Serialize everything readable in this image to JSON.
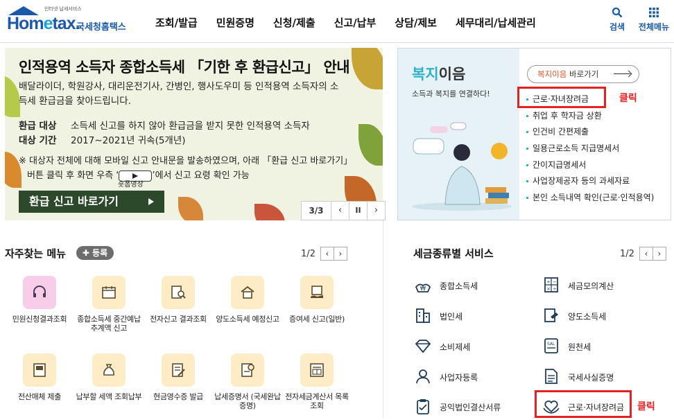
{
  "header": {
    "logo_small": "인터넷 납세서비스",
    "logo_word_a": "Hom",
    "logo_word_e": "e",
    "logo_word_b": "tax.",
    "logo_sub": "국세청홈택스",
    "nav": [
      "조회/발급",
      "민원증명",
      "신청/제출",
      "신고/납부",
      "상담/제보",
      "세무대리/납세관리"
    ],
    "search_label": "검색",
    "menu_label": "전체메뉴"
  },
  "banner": {
    "title": "인적용역 소득자 종합소득세 「기한 후 환급신고」 안내",
    "desc": "배달라이더, 학원강사, 대리운전기사, 간병인, 행사도우미 등 인적용역 소득자의 소득세 환급금을 찾아드립니다.",
    "row1_label": "환급 대상",
    "row1_value": "소득세 신고를 하지 않아 환급금을 받지 못한 인적용역 소득자",
    "row2_label": "대상 기간",
    "row2_value": "2017∼2021년 귀속(5개년)",
    "note_a": "※ 대상자 전체에 대해 모바일 신고 안내문을 발송하였으며, 아래 「환급 신고 바로가기」",
    "note_b1": "버튼 클릭 후 화면 우측 ‘",
    "note_b2": "’에서 신고 요령 확인 가능",
    "video_label": "숏폼영상",
    "button": "환급 신고 바로가기",
    "page": "3/3",
    "prev": "‹",
    "pause": "II",
    "next": "›"
  },
  "welfare": {
    "title_acc": "복지",
    "title_rest": "이음",
    "subtitle": "소득과 복지를 연결하다!",
    "go_acc": "복지이음",
    "go_rest": " 바로가기",
    "items": [
      "근로·자녀장려금",
      "취업 후 학자금 상환",
      "인건비 간편제출",
      "일용근로소득 지급명세서",
      "간이지급명세서",
      "사업장제공자 등의 과세자료",
      "본인 소득내역 확인(근로·인적용역)"
    ],
    "click_label": "클릭"
  },
  "favorites": {
    "title": "자주찾는 메뉴",
    "register": "✚ 등록",
    "page": "1/2",
    "prev": "‹",
    "next": "›",
    "items": [
      {
        "label": "민원신청결과조회",
        "icon": "headset-icon"
      },
      {
        "label": "종합소득세 중간예납추계액 신고",
        "icon": "calendar-icon"
      },
      {
        "label": "전자신고 결과조회",
        "icon": "document-search-icon"
      },
      {
        "label": "양도소득세 예정신고",
        "icon": "house-icon"
      },
      {
        "label": "증여세 신고(일반)",
        "icon": "gift-money-icon"
      },
      {
        "label": "전산매체 제출",
        "icon": "media-icon"
      },
      {
        "label": "납부할 세액 조회납부",
        "icon": "money-bag-icon"
      },
      {
        "label": "현금영수증 발급",
        "icon": "receipt-icon"
      },
      {
        "label": "납세증명서 (국세완납증명)",
        "icon": "certificate-icon"
      },
      {
        "label": "전자세금계산서 목록조회",
        "icon": "invoice-list-icon"
      }
    ]
  },
  "tax_services": {
    "title": "세금종류별 서비스",
    "page": "1/2",
    "prev": "‹",
    "next": "›",
    "items": [
      {
        "label": "종합소득세",
        "icon": "income-tax-icon"
      },
      {
        "label": "세금모의계산",
        "icon": "calculator-icon"
      },
      {
        "label": "법인세",
        "icon": "building-icon"
      },
      {
        "label": "양도소득세",
        "icon": "transfer-icon"
      },
      {
        "label": "소비제세",
        "icon": "diamond-icon"
      },
      {
        "label": "원천세",
        "icon": "salary-icon"
      },
      {
        "label": "사업자등록",
        "icon": "person-icon"
      },
      {
        "label": "국세사실증명",
        "icon": "document-icon"
      },
      {
        "label": "공익법인결산서류",
        "icon": "clipboard-icon"
      },
      {
        "label": "근로·자녀장려금",
        "icon": "heart-hands-icon"
      }
    ],
    "click_label": "클릭"
  },
  "colors": {
    "brand": "#1a5aa8",
    "welfare_accent": "#2db3c8",
    "highlight": "#e52020",
    "banner_button": "#2c4a2b"
  }
}
